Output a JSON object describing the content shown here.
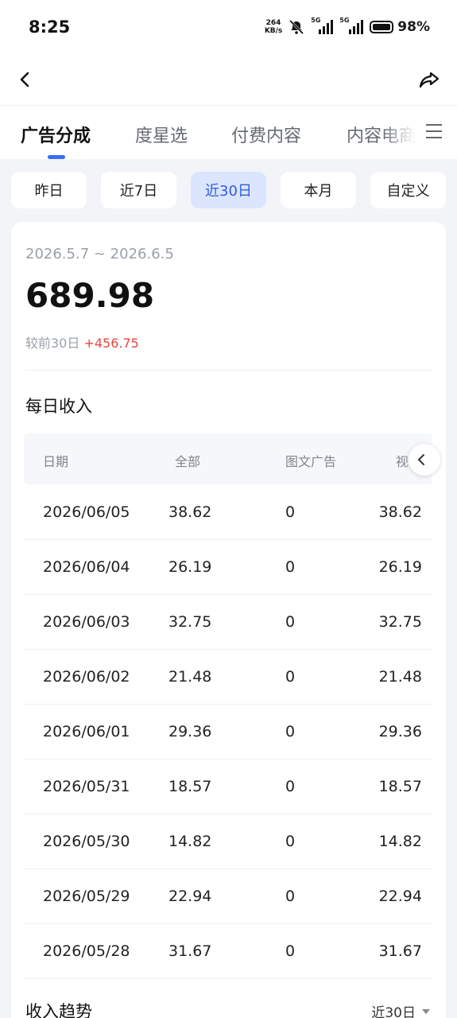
{
  "status_bar": {
    "time": "8:25",
    "net_speed_value": "264",
    "net_speed_unit": "KB/s",
    "signal_label_1": "5G",
    "signal_label_2": "5G",
    "battery": "98%"
  },
  "header": {
    "back_icon": "chevron-left-icon",
    "share_icon": "share-arrow-icon"
  },
  "tabs": [
    {
      "label": "广告分成",
      "active": true
    },
    {
      "label": "度星选",
      "active": false
    },
    {
      "label": "付费内容",
      "active": false
    },
    {
      "label": "内容电商",
      "active": false
    }
  ],
  "range_filters": [
    {
      "label": "昨日",
      "active": false
    },
    {
      "label": "近7日",
      "active": false
    },
    {
      "label": "近30日",
      "active": true
    },
    {
      "label": "本月",
      "active": false
    },
    {
      "label": "自定义",
      "active": false
    }
  ],
  "summary": {
    "date_range": "2026.5.7 ~ 2026.6.5",
    "total": "689.98",
    "compare_label": "较前30日",
    "compare_value": "+456.75"
  },
  "daily_income": {
    "title": "每日收入",
    "columns": [
      "日期",
      "全部",
      "图文广告",
      "视"
    ],
    "rows": [
      [
        "2026/06/05",
        "38.62",
        "0",
        "38.62"
      ],
      [
        "2026/06/04",
        "26.19",
        "0",
        "26.19"
      ],
      [
        "2026/06/03",
        "32.75",
        "0",
        "32.75"
      ],
      [
        "2026/06/02",
        "21.48",
        "0",
        "21.48"
      ],
      [
        "2026/06/01",
        "29.36",
        "0",
        "29.36"
      ],
      [
        "2026/05/31",
        "18.57",
        "0",
        "18.57"
      ],
      [
        "2026/05/30",
        "14.82",
        "0",
        "14.82"
      ],
      [
        "2026/05/29",
        "22.94",
        "0",
        "22.94"
      ],
      [
        "2026/05/28",
        "31.67",
        "0",
        "31.67"
      ]
    ]
  },
  "trend": {
    "title": "收入趋势",
    "range": "近30日"
  },
  "colors": {
    "accent": "#3b6cf5",
    "increase": "#e8473b",
    "active_chip_bg": "#dbe5fd"
  }
}
